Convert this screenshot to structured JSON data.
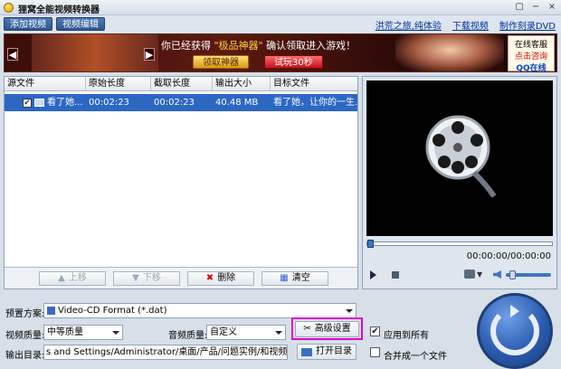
{
  "window": {
    "title": "狸窝全能视频转换器",
    "controls": [
      "▢",
      "−",
      "×"
    ]
  },
  "menu": {
    "add_video": "添加视频",
    "edit_video": "视频编辑",
    "links": [
      "洪荒之旅,纯体验",
      "下载视频",
      "制作刻录DVD"
    ]
  },
  "banner": {
    "text_prefix": "你已经获得",
    "text_highlight": "\"极品神器\"",
    "text_suffix": "确认领取进入游戏！",
    "btn_claim": "领取神器",
    "btn_trial": "试玩30秒",
    "cs_line1": "在线客服",
    "cs_line2": "点击咨询",
    "cs_qq": "QQ在线"
  },
  "table": {
    "headers": [
      "源文件",
      "原始长度",
      "截取长度",
      "输出大小",
      "目标文件"
    ],
    "rows": [
      {
        "checked": true,
        "source": "看了她...",
        "orig_len": "00:02:23",
        "cut_len": "00:02:23",
        "out_size": "40.48 MB",
        "target": "看了她，让你的一生..."
      }
    ],
    "buttons": {
      "move_up": "上移",
      "move_down": "下移",
      "delete": "删除",
      "clear": "清空"
    }
  },
  "preview": {
    "time": "00:00:00/00:00:00",
    "progress": 0,
    "volume": 0.1
  },
  "settings": {
    "preset_label": "预置方案:",
    "preset_value": "Video-CD Format (*.dat)",
    "video_quality_label": "视频质量:",
    "video_quality_value": "中等质量",
    "audio_quality_label": "音频质量:",
    "audio_quality_value": "自定义",
    "advanced_button": "高级设置",
    "apply_all_label": "应用到所有",
    "apply_all_checked": true,
    "output_label": "输出目录:",
    "output_path": "s and Settings/Administrator/桌面/产品/问题实例/和视频原件/转换",
    "open_dir_button": "打开目录",
    "merge_label": "合并成一个文件",
    "merge_checked": false
  },
  "colors": {
    "selected_row": "#2c67c4",
    "highlight_border": "#e000c8"
  }
}
